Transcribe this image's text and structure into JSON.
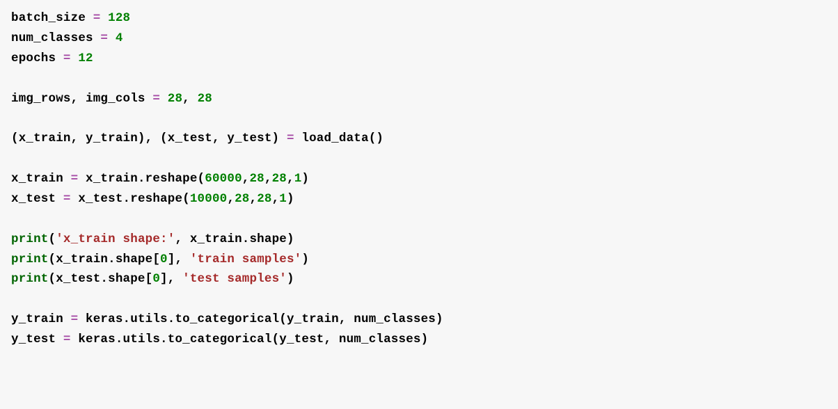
{
  "code": {
    "line1": {
      "v1": "batch_size ",
      "op": "=",
      "sp": " ",
      "n1": "128"
    },
    "line2": {
      "v1": "num_classes ",
      "op": "=",
      "sp": " ",
      "n1": "4"
    },
    "line3": {
      "v1": "epochs ",
      "op": "=",
      "sp": " ",
      "n1": "12"
    },
    "line5": {
      "v1": "img_rows, img_cols ",
      "op": "=",
      "sp": " ",
      "n1": "28",
      "c": ", ",
      "n2": "28"
    },
    "line7": {
      "v1": "(x_train, y_train), (x_test, y_test) ",
      "op": "=",
      "v2": " load_data()"
    },
    "line9": {
      "v1": "x_train ",
      "op": "=",
      "v2": " x_train.reshape(",
      "n1": "60000",
      "c1": ",",
      "n2": "28",
      "c2": ",",
      "n3": "28",
      "c3": ",",
      "n4": "1",
      "v3": ")"
    },
    "line10": {
      "v1": "x_test ",
      "op": "=",
      "v2": " x_test.reshape(",
      "n1": "10000",
      "c1": ",",
      "n2": "28",
      "c2": ",",
      "n3": "28",
      "c3": ",",
      "n4": "1",
      "v3": ")"
    },
    "line12": {
      "f": "print",
      "p1": "(",
      "s1": "'x_train shape:'",
      "c": ", x_train.shape)"
    },
    "line13": {
      "f": "print",
      "p1": "(x_train.shape[",
      "n1": "0",
      "p2": "], ",
      "s1": "'train samples'",
      "p3": ")"
    },
    "line14": {
      "f": "print",
      "p1": "(x_test.shape[",
      "n1": "0",
      "p2": "], ",
      "s1": "'test samples'",
      "p3": ")"
    },
    "line16": {
      "v1": "y_train ",
      "op": "=",
      "v2": " keras.utils.to_categorical(y_train, num_classes)"
    },
    "line17": {
      "v1": "y_test ",
      "op": "=",
      "v2": " keras.utils.to_categorical(y_test, num_classes)"
    }
  }
}
